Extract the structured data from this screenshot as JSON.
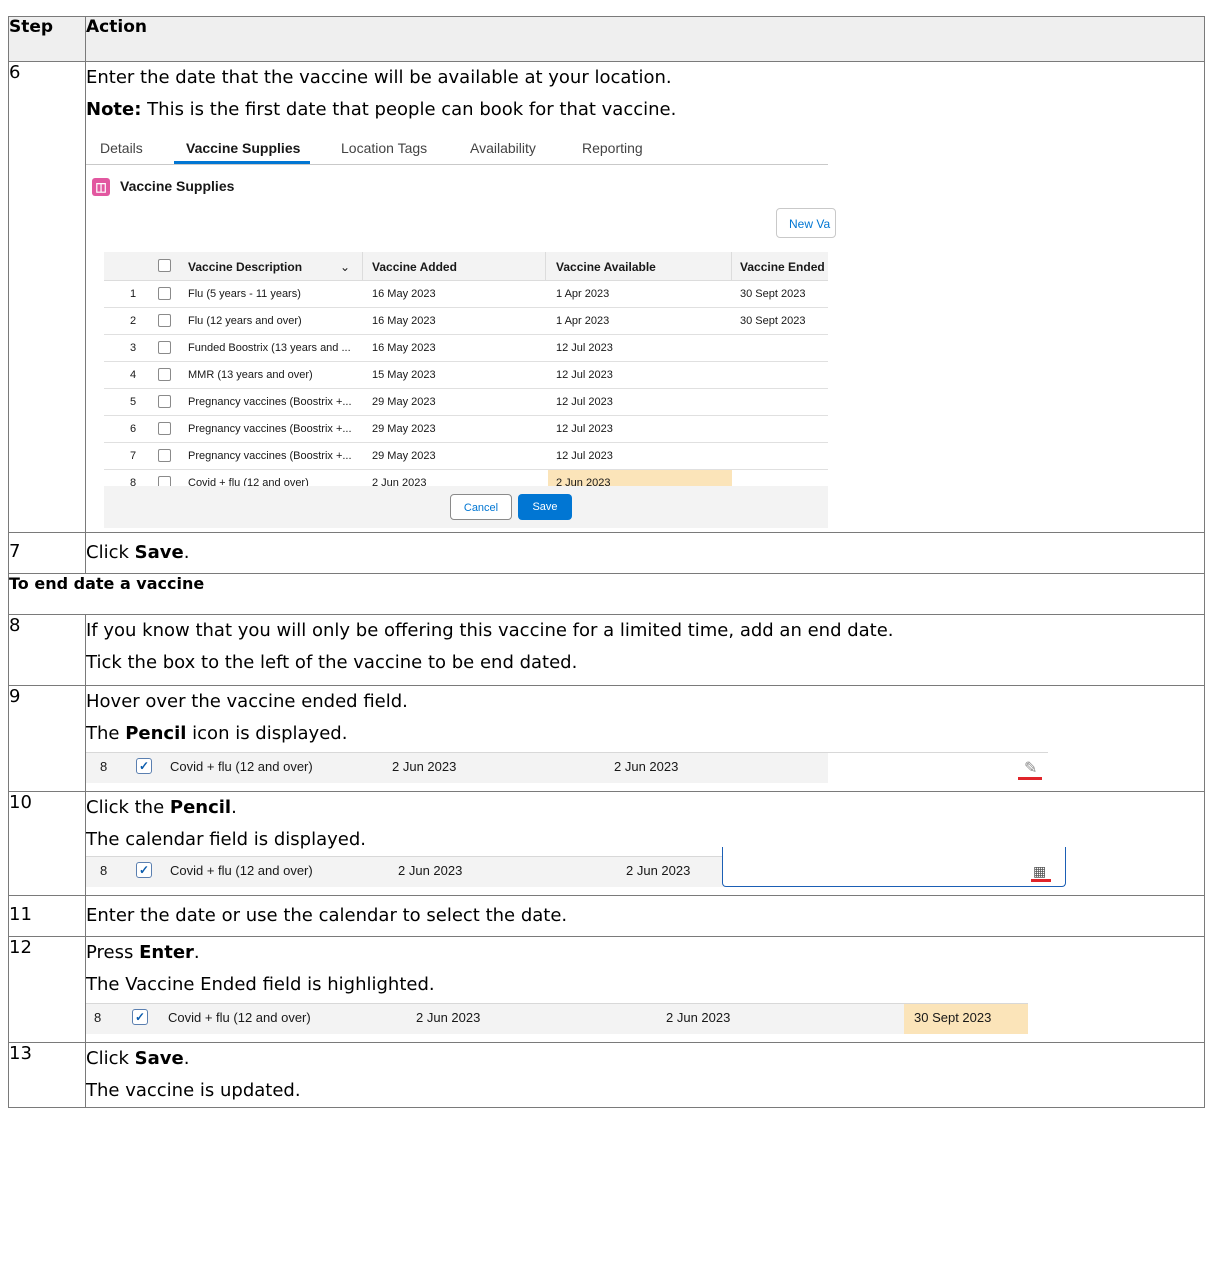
{
  "header": {
    "step": "Step",
    "action": "Action"
  },
  "step6": {
    "num": "6",
    "line1": "Enter the date that the vaccine will be available at your location.",
    "note_label": "Note:",
    "note_text": " This is the first date that people can book for that vaccine.",
    "screenshot": {
      "tabs": [
        "Details",
        "Vaccine Supplies",
        "Location Tags",
        "Availability",
        "Reporting"
      ],
      "active_tab": "Vaccine Supplies",
      "section_title": "Vaccine Supplies",
      "new_button": "New Va",
      "columns": [
        "Vaccine Description",
        "Vaccine Added",
        "Vaccine Available",
        "Vaccine Ended"
      ],
      "rows": [
        {
          "n": "1",
          "desc": "Flu (5 years - 11 years)",
          "added": "16 May 2023",
          "available": "1 Apr 2023",
          "ended": "30 Sept 2023"
        },
        {
          "n": "2",
          "desc": "Flu (12 years and over)",
          "added": "16 May 2023",
          "available": "1 Apr 2023",
          "ended": "30 Sept 2023"
        },
        {
          "n": "3",
          "desc": "Funded Boostrix (13 years and ...",
          "added": "16 May 2023",
          "available": "12 Jul 2023",
          "ended": ""
        },
        {
          "n": "4",
          "desc": "MMR (13 years and over)",
          "added": "15 May 2023",
          "available": "12 Jul 2023",
          "ended": ""
        },
        {
          "n": "5",
          "desc": "Pregnancy vaccines (Boostrix +...",
          "added": "29 May 2023",
          "available": "12 Jul 2023",
          "ended": ""
        },
        {
          "n": "6",
          "desc": "Pregnancy vaccines (Boostrix +...",
          "added": "29 May 2023",
          "available": "12 Jul 2023",
          "ended": ""
        },
        {
          "n": "7",
          "desc": "Pregnancy vaccines (Boostrix +...",
          "added": "29 May 2023",
          "available": "12 Jul 2023",
          "ended": ""
        },
        {
          "n": "8",
          "desc": "Covid + flu (12 and over)",
          "added": "2 Jun 2023",
          "available": "2 Jun 2023",
          "ended": ""
        }
      ],
      "cancel": "Cancel",
      "save": "Save"
    }
  },
  "step7": {
    "num": "7",
    "pre": "Click ",
    "bold": "Save",
    "post": "."
  },
  "section": "To end date a vaccine",
  "step8": {
    "num": "8",
    "line1": "If you know that you will only be offering this vaccine for a limited time, add an end date.",
    "line2": "Tick the box to the left of the vaccine to be end dated."
  },
  "step9": {
    "num": "9",
    "line1": "Hover over the vaccine ended field.",
    "pre": "The ",
    "bold": "Pencil",
    "post": " icon is displayed."
  },
  "step10": {
    "num": "10",
    "pre": "Click the ",
    "bold": "Pencil",
    "post": ".",
    "line2": "The calendar field is displayed."
  },
  "step11": {
    "num": "11",
    "line1": "Enter the date or use the calendar to select the date."
  },
  "step12": {
    "num": "12",
    "pre": "Press ",
    "bold": "Enter",
    "post": ".",
    "line2": "The Vaccine Ended field is highlighted."
  },
  "step13": {
    "num": "13",
    "pre": "Click ",
    "bold": "Save",
    "post": ".",
    "line2": "The vaccine is updated."
  },
  "strip_row": {
    "n": "8",
    "check": "✓",
    "desc": "Covid + flu (12 and over)",
    "added": "2 Jun 2023",
    "available": "2 Jun 2023",
    "ended": "30 Sept 2023"
  }
}
